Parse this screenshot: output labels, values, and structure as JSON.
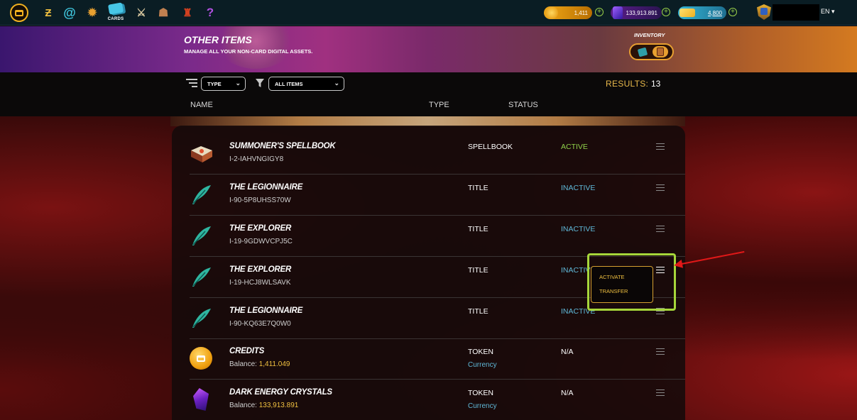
{
  "nav": {
    "icons": [
      "logo-icon",
      "battle-icon",
      "swirl-icon",
      "gear-icon",
      "cards-icon",
      "sword-icon",
      "shop-icon",
      "castle-icon",
      "question-icon"
    ],
    "cards_label": "CARDS",
    "credits": "1,411",
    "dec": "133,913.891",
    "sps": "4,800",
    "language": "EN ▾"
  },
  "banner": {
    "title": "OTHER ITEMS",
    "subtitle": "MANAGE ALL YOUR NON-CARD DIGITAL ASSETS.",
    "inventory_label": "INVENTORY"
  },
  "filters": {
    "type_select": "TYPE",
    "items_select": "ALL ITEMS",
    "results_label": "RESULTS:",
    "results_count": "13"
  },
  "columns": {
    "name": "NAME",
    "type": "TYPE",
    "status": "STATUS"
  },
  "items": [
    {
      "name": "SUMMONER'S SPELLBOOK",
      "sub": "I-2-IAHVNGIGY8",
      "type": "SPELLBOOK",
      "status": "ACTIVE",
      "icon": "spellbook-icon"
    },
    {
      "name": "THE LEGIONNAIRE",
      "sub": "I-90-5P8UHSS70W",
      "type": "TITLE",
      "status": "INACTIVE",
      "icon": "feather-icon"
    },
    {
      "name": "THE EXPLORER",
      "sub": "I-19-9GDWVCPJ5C",
      "type": "TITLE",
      "status": "INACTIVE",
      "icon": "feather-icon"
    },
    {
      "name": "THE EXPLORER",
      "sub": "I-19-HCJ8WLSAVK",
      "type": "TITLE",
      "status": "INACTIVE",
      "icon": "feather-icon"
    },
    {
      "name": "THE LEGIONNAIRE",
      "sub": "I-90-KQ63E7Q0W0",
      "type": "TITLE",
      "status": "INACTIVE",
      "icon": "feather-icon"
    },
    {
      "name": "CREDITS",
      "sub_label": "Balance: ",
      "sub_value": "1,411.049",
      "type": "TOKEN",
      "type2": "Currency",
      "status": "N/A",
      "icon": "credits-coin-icon"
    },
    {
      "name": "DARK ENERGY CRYSTALS",
      "sub_label": "Balance: ",
      "sub_value": "133,913.891",
      "type": "TOKEN",
      "type2": "Currency",
      "status": "N/A",
      "icon": "dec-crystal-icon"
    }
  ],
  "popup_menu": {
    "activate": "ACTIVATE",
    "transfer": "TRANSFER"
  },
  "colors": {
    "active": "#8fd04a",
    "inactive": "#5fb8d8",
    "na": "#ffffff",
    "accent": "#e8b84a",
    "highlight": "#a6d63a",
    "arrow": "#e01818"
  }
}
